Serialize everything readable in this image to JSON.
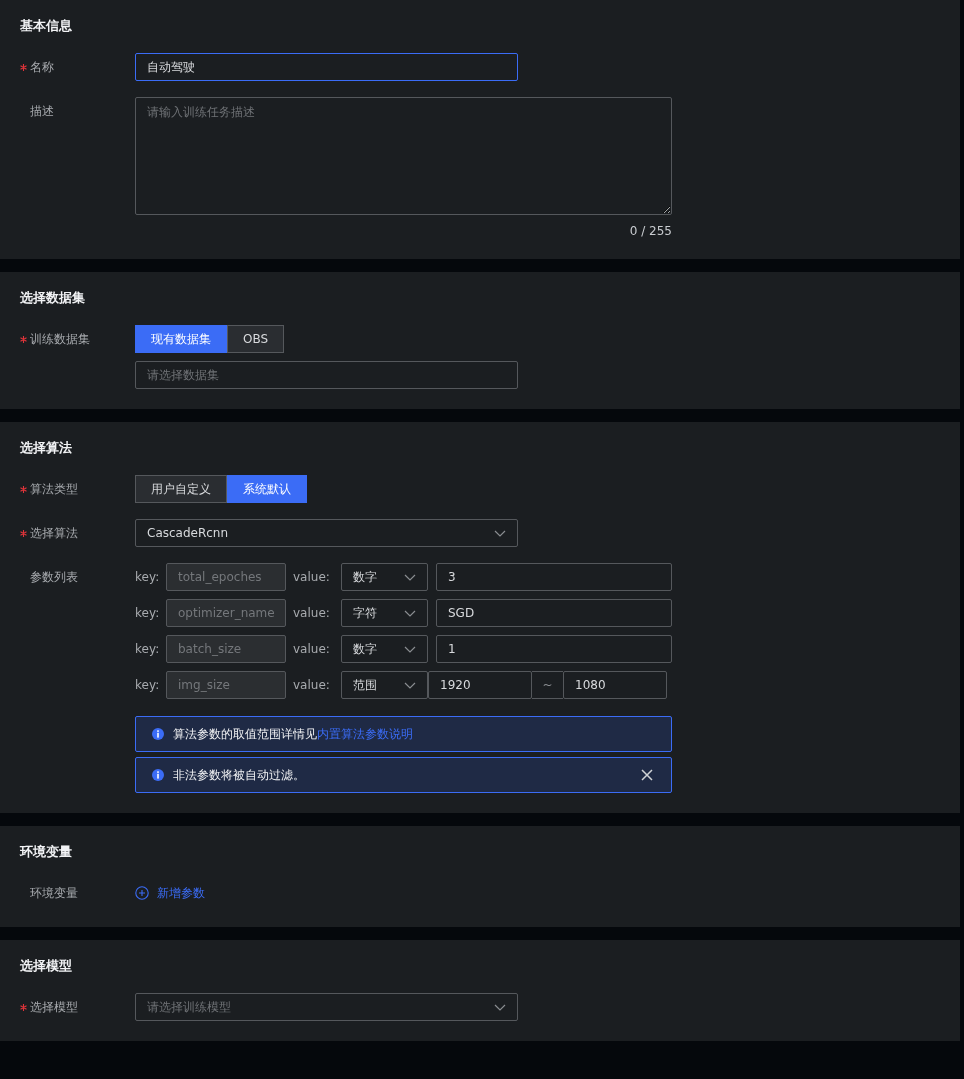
{
  "sections": [
    {
      "title": "基本信息",
      "fields": [
        {
          "kind": "text",
          "label": "名称",
          "required": true,
          "value": "自动驾驶",
          "focused": true
        },
        {
          "kind": "textarea",
          "label": "描述",
          "required": false,
          "placeholder": "请输入训练任务描述",
          "counter": "0 / 255"
        }
      ]
    },
    {
      "title": "选择数据集",
      "fields": [
        {
          "kind": "toggle",
          "label": "训练数据集",
          "required": true,
          "options": [
            {
              "label": "现有数据集",
              "selected": true
            },
            {
              "label": "OBS",
              "selected": false
            }
          ],
          "input_placeholder": "请选择数据集"
        }
      ]
    },
    {
      "title": "选择算法",
      "fields": [
        {
          "kind": "toggle",
          "label": "算法类型",
          "required": true,
          "options": [
            {
              "label": "用户自定义",
              "selected": false
            },
            {
              "label": "系统默认",
              "selected": true
            }
          ]
        },
        {
          "kind": "select",
          "label": "选择算法",
          "required": true,
          "value": "CascadeRcnn"
        },
        {
          "kind": "params",
          "label": "参数列表",
          "required": false,
          "rows": [
            {
              "key_label": "key:",
              "key": "total_epoches",
              "value_label": "value:",
              "type": "数字",
              "values": [
                "3"
              ]
            },
            {
              "key_label": "key:",
              "key": "optimizer_name",
              "value_label": "value:",
              "type": "字符",
              "values": [
                "SGD"
              ]
            },
            {
              "key_label": "key:",
              "key": "batch_size",
              "value_label": "value:",
              "type": "数字",
              "values": [
                "1"
              ]
            },
            {
              "key_label": "key:",
              "key": "img_size",
              "value_label": "value:",
              "type": "范围",
              "values": [
                "1920",
                "1080"
              ],
              "separator": "~"
            }
          ],
          "alerts": [
            {
              "text": "算法参数的取值范围详情见",
              "link": "内置算法参数说明",
              "closable": false
            },
            {
              "text": "非法参数将被自动过滤。",
              "closable": true
            }
          ]
        }
      ]
    },
    {
      "title": "环境变量",
      "fields": [
        {
          "kind": "add",
          "label": "环境变量",
          "required": false,
          "link": "新增参数"
        }
      ]
    },
    {
      "title": "选择模型",
      "fields": [
        {
          "kind": "select",
          "label": "选择模型",
          "required": true,
          "placeholder": "请选择训练模型"
        }
      ]
    }
  ]
}
